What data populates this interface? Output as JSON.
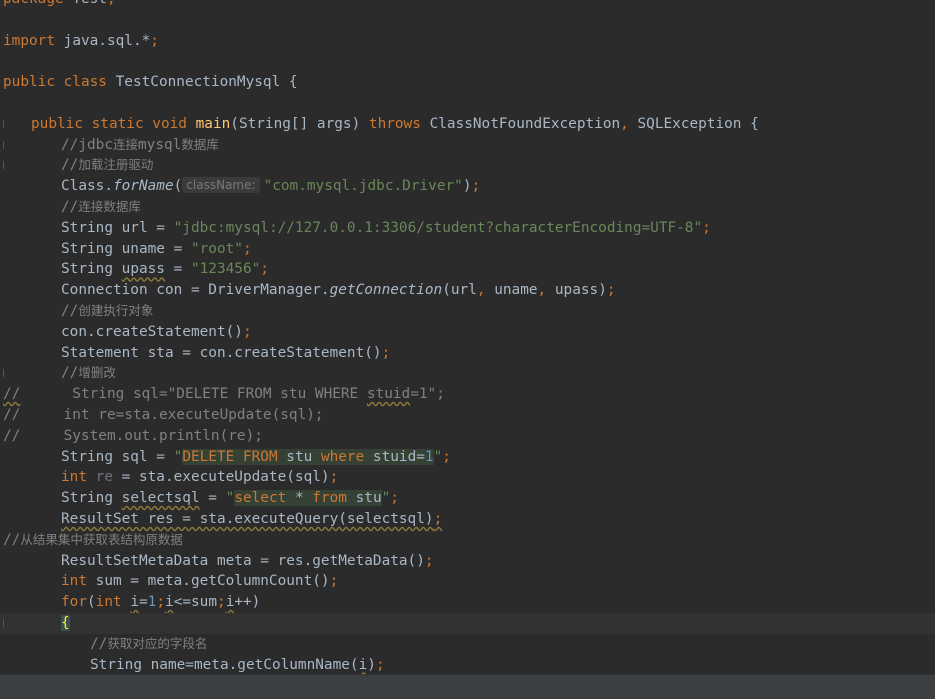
{
  "editor": {
    "lines": [
      {
        "indent": 0,
        "html": "<span class='kw'>package </span>Test<span class='kw'>;</span>"
      },
      {
        "indent": 0,
        "html": ""
      },
      {
        "indent": 0,
        "html": "<span class='kw'>import </span>java.sql.*<span class='kw'>;</span>"
      },
      {
        "indent": 0,
        "html": ""
      },
      {
        "indent": 0,
        "html": "<span class='kw'>public class </span>TestConnectionMysql {"
      },
      {
        "indent": 0,
        "html": ""
      },
      {
        "indent": 1,
        "gutter": true,
        "html": "<span class='kw'>public static void </span><span class='fn'>main</span>(String[] args) <span class='kw'>throws </span>ClassNotFoundException<span class='kw'>, </span>SQLException {"
      },
      {
        "indent": 2,
        "gutter": true,
        "html": "<span class='cmt'>//jdbc</span><span class='cmt-cn'>连接</span><span class='cmt'>mysql</span><span class='cmt-cn'>数据库</span>"
      },
      {
        "indent": 2,
        "gutter": true,
        "html": "<span class='cmt'>//</span><span class='cmt-cn'>加载注册驱动</span>"
      },
      {
        "indent": 2,
        "html": "Class.<span class='ital'>forName</span>(<span class='hint'>className:</span><span class='str'>\"com.mysql.jdbc.Driver\"</span>)<span class='kw'>;</span>"
      },
      {
        "indent": 2,
        "html": "<span class='cmt'>//</span><span class='cmt-cn'>连接数据库</span>"
      },
      {
        "indent": 2,
        "html": "String url = <span class='str'>\"jdbc:mysql://127.0.0.1:3306/student?characterEncoding=UTF-8\"</span><span class='kw'>;</span>"
      },
      {
        "indent": 2,
        "html": "String uname = <span class='str'>\"root\"</span><span class='kw'>;</span>"
      },
      {
        "indent": 2,
        "html": "String <span class='warn'>upass</span> = <span class='str'>\"123456\"</span><span class='kw'>;</span>"
      },
      {
        "indent": 2,
        "html": "Connection con = DriverManager.<span class='ital'>getConnection</span>(url<span class='kw'>, </span>uname<span class='kw'>, </span>upass)<span class='kw'>;</span>"
      },
      {
        "indent": 2,
        "html": "<span class='cmt'>//</span><span class='cmt-cn'>创建执行对象</span>"
      },
      {
        "indent": 2,
        "html": "con.createStatement()<span class='kw'>;</span>"
      },
      {
        "indent": 2,
        "html": "Statement sta = con.createStatement()<span class='kw'>;</span>"
      },
      {
        "indent": 2,
        "gutter": true,
        "html": "<span class='cmt'>//</span><span class='cmt-cn'>增删改</span>"
      },
      {
        "indent": 0,
        "html": "<span class='cmt'><span class='warn'>//</span>      String sql=\"DELETE FROM stu WHERE <span class='warn'>stuid</span>=1\";</span>"
      },
      {
        "indent": 0,
        "html": "<span class='cmt'>//     int re=sta.executeUpdate(sql);</span>"
      },
      {
        "indent": 0,
        "html": "<span class='cmt'>//     System.out.println(re);</span>"
      },
      {
        "indent": 2,
        "html": "String sql = <span class='str'>\"</span><span class='sqlhl'><span class='kw'>DELETE FROM </span>stu <span class='kw'>where </span>stuid=<span class='num'>1</span></span><span class='str'>\"</span><span class='kw'>;</span>"
      },
      {
        "indent": 2,
        "html": "<span class='kw'>int </span><span class='unused'>re</span> = sta.executeUpdate(sql)<span class='kw'>;</span>"
      },
      {
        "indent": 2,
        "html": "String <span class='warn'>selectsql</span> = <span class='str'>\"</span><span class='sqlhl'><span class='kw'>select </span>* <span class='kw'>from </span>stu</span><span class='str'>\"</span><span class='kw'>;</span>"
      },
      {
        "indent": 2,
        "html": "<span class='warn'>ResultSet res = sta.executeQuery(selectsql)<span class='kw'>;</span></span>"
      },
      {
        "indent": 0,
        "html": "<span class='cmt'>//</span><span class='cmt-cn'>从结果集中获取表结构原数据</span>"
      },
      {
        "indent": 2,
        "html": "ResultSetMetaData meta = res.getMetaData()<span class='kw'>;</span>"
      },
      {
        "indent": 2,
        "html": "<span class='kw'>int </span>sum = meta.getColumnCount()<span class='kw'>;</span>"
      },
      {
        "indent": 2,
        "html": "<span class='kw'>for</span>(<span class='kw'>int </span><span class='warn'>i</span>=<span class='num'>1</span><span class='kw'>;</span><span class='warn'>i</span>&lt;=sum<span class='kw'>;</span><span class='warn'>i</span>++)"
      },
      {
        "indent": 2,
        "gutter": true,
        "current": true,
        "html": "<span class='brace'>{</span>"
      },
      {
        "indent": 3,
        "html": "<span class='cmt'>//</span><span class='cmt-cn'>获取对应的字段名</span>"
      },
      {
        "indent": 3,
        "html": "String name=meta.getColumnName(<span class='warn'>i</span>)<span class='kw'>;</span>"
      }
    ]
  }
}
